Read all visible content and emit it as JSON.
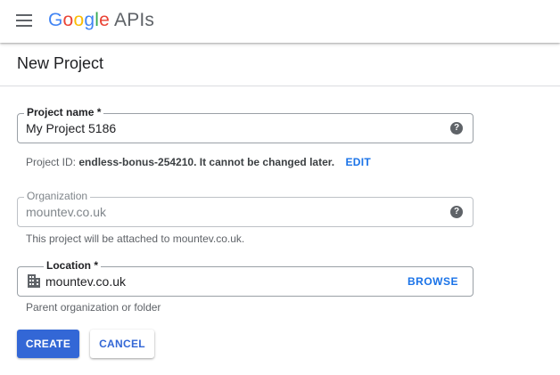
{
  "header": {
    "logo_letters": [
      "G",
      "o",
      "o",
      "g",
      "l",
      "e"
    ],
    "logo_suffix": "APIs",
    "menu_icon": "hamburger-menu-icon"
  },
  "page": {
    "title": "New Project"
  },
  "project_name": {
    "label": "Project name *",
    "value": "My Project 5186",
    "help_icon": "help-icon",
    "help_glyph": "?"
  },
  "project_id": {
    "prefix": "Project ID:",
    "id": "endless-bonus-254210",
    "suffix": ". It cannot be changed later.",
    "edit_label": "EDIT"
  },
  "organization": {
    "label": "Organization",
    "value": "mountev.co.uk",
    "help_icon": "help-icon",
    "help_glyph": "?",
    "hint": "This project will be attached to mountev.co.uk."
  },
  "location": {
    "label": "Location *",
    "value": "mountev.co.uk",
    "icon": "building-icon",
    "browse_label": "BROWSE",
    "hint": "Parent organization or folder"
  },
  "actions": {
    "create_label": "CREATE",
    "cancel_label": "CANCEL"
  },
  "colors": {
    "primary": "#3367d6",
    "link": "#1a73e8"
  }
}
